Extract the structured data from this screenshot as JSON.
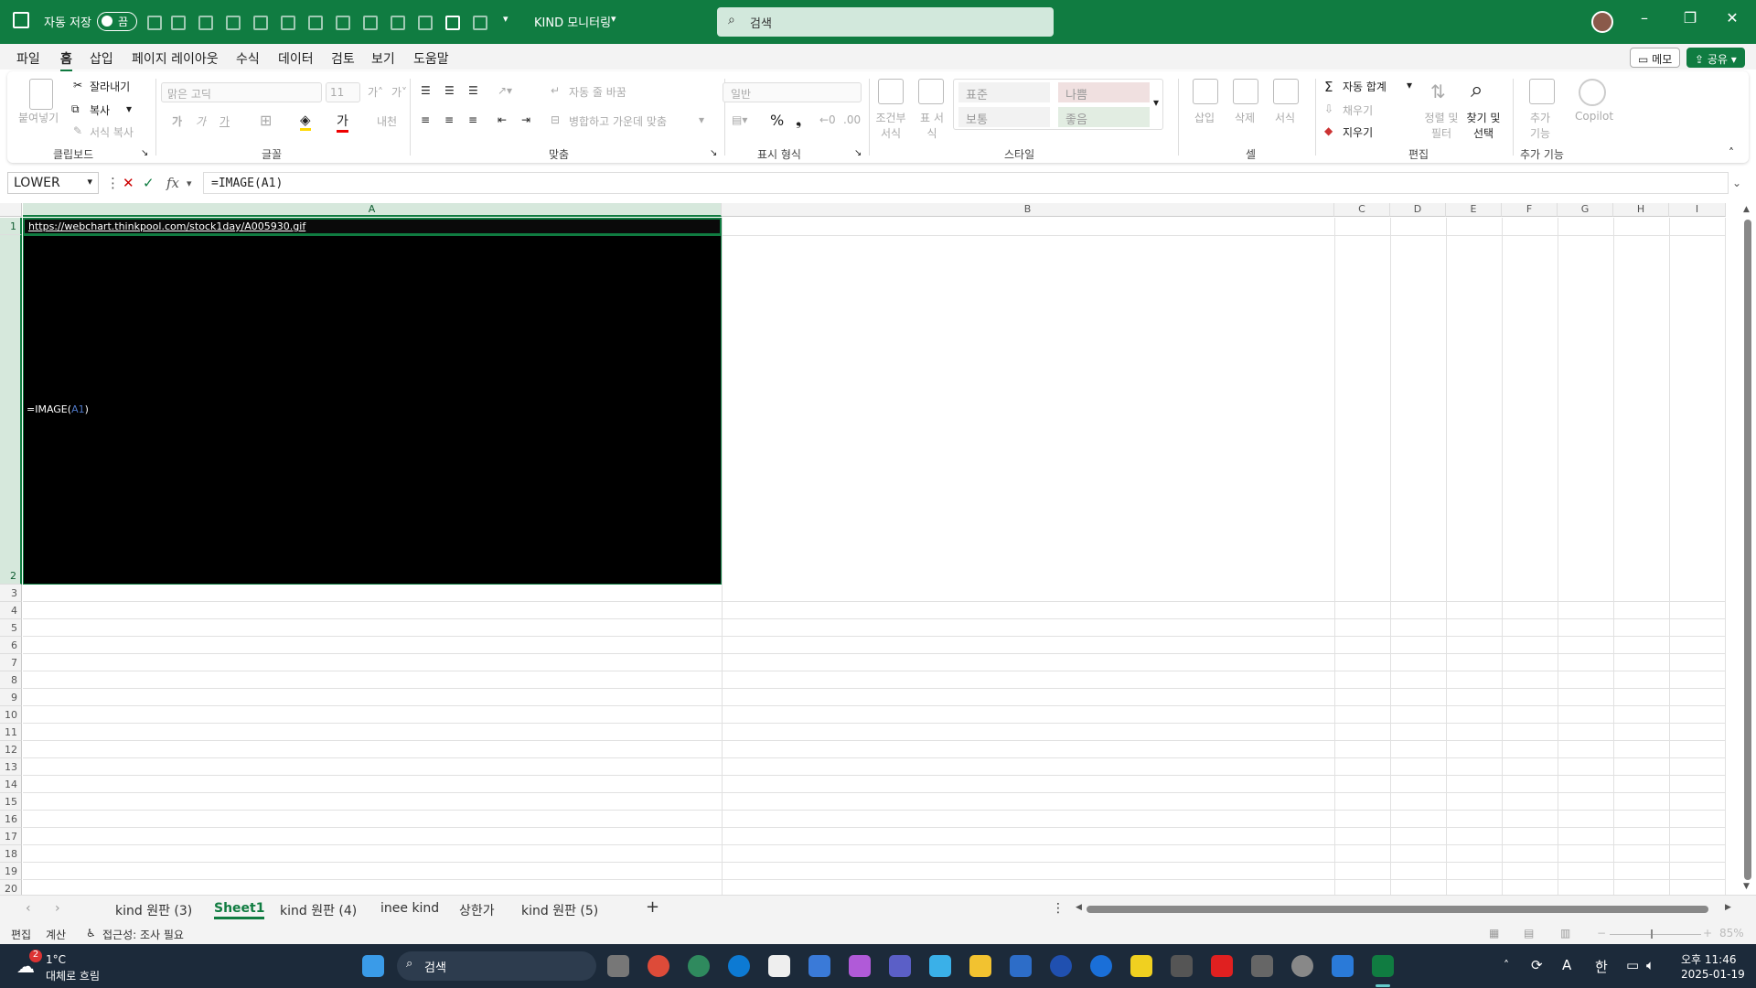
{
  "title_bar": {
    "autosave_label": "자동 저장",
    "autosave_state": "끔",
    "doc_title": "KIND 모니터링",
    "search_placeholder": "검색"
  },
  "menu": [
    "파일",
    "홈",
    "삽입",
    "페이지 레이아웃",
    "수식",
    "데이터",
    "검토",
    "보기",
    "도움말"
  ],
  "menu_active": "홈",
  "top_buttons": {
    "memo": "메모",
    "share": "공유"
  },
  "ribbon": {
    "clipboard": {
      "paste": "붙여넣기",
      "cut": "잘라내기",
      "copy": "복사",
      "format_painter": "서식 복사",
      "group": "클립보드"
    },
    "font": {
      "name": "맑은 고딕",
      "size": "11",
      "group": "글꼴"
    },
    "align": {
      "wrap": "자동 줄 바꿈",
      "merge": "병합하고 가운데 맞춤",
      "group": "맞춤"
    },
    "number": {
      "format": "일반",
      "group": "표시 형식"
    },
    "styles": {
      "conditional": "조건부 서식",
      "table": "표 서식",
      "normal": "표준",
      "bad": "나쁨",
      "neutral": "보통",
      "good": "좋음",
      "group": "스타일"
    },
    "cells": {
      "insert": "삽입",
      "delete": "삭제",
      "format": "서식",
      "group": "셀"
    },
    "editing": {
      "autosum": "자동 합계",
      "fill": "채우기",
      "clear": "지우기",
      "sort": "정렬 및 필터",
      "find": "찾기 및 선택",
      "group": "편집"
    },
    "addins": {
      "addins": "추가 기능",
      "copilot": "Copilot",
      "group": "추가 기능"
    }
  },
  "formula_bar": {
    "name_box": "LOWER",
    "formula": "=IMAGE(A1)"
  },
  "grid": {
    "columns": [
      "A",
      "B",
      "C",
      "D",
      "E",
      "F",
      "G",
      "H",
      "I"
    ],
    "rows": [
      "1",
      "2",
      "3",
      "4",
      "5",
      "6",
      "7",
      "8",
      "9",
      "10",
      "11",
      "12",
      "13",
      "14",
      "15",
      "16",
      "17",
      "18",
      "19",
      "20"
    ],
    "a1": "https://webchart.thinkpool.com/stock1day/A005930.gif",
    "a2_formula": "=IMAGE(",
    "a2_ref": "A1",
    "a2_close": ")"
  },
  "sheets": [
    "kind 원판 (3)",
    "Sheet1",
    "kind 원판 (4)",
    "inee kind",
    "상한가",
    "kind 원판 (5)"
  ],
  "active_sheet": "Sheet1",
  "status": {
    "mode": "편집",
    "calc": "계산",
    "accessibility": "접근성: 조사 필요",
    "zoom": "85%"
  },
  "taskbar": {
    "weather_temp": "1°C",
    "weather_desc": "대체로 흐림",
    "weather_badge": "2",
    "search": "검색",
    "ime_a": "A",
    "ime_ko": "한",
    "time": "오후 11:46",
    "date": "2025-01-19"
  }
}
